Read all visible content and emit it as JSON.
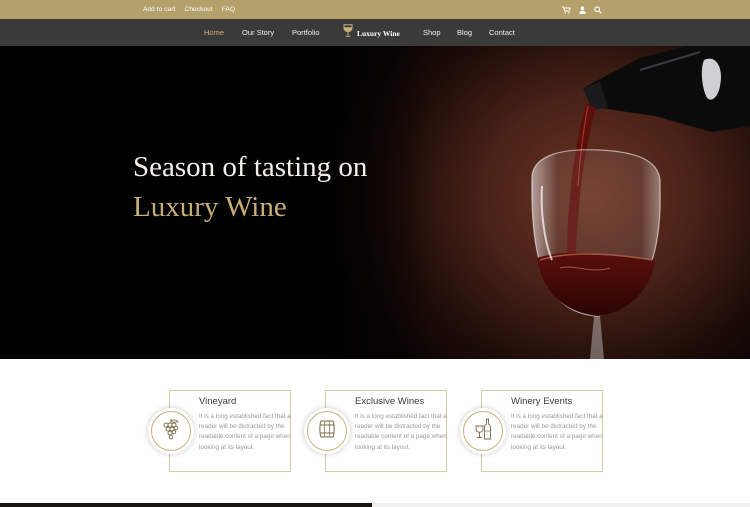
{
  "topbar": {
    "links": [
      "Add to cart",
      "Checkout",
      "FAQ"
    ],
    "icons": [
      "cart-icon",
      "user-icon",
      "search-icon"
    ]
  },
  "nav": {
    "items": [
      {
        "label": "Home",
        "active": true
      },
      {
        "label": "Our Story"
      },
      {
        "label": "Portfolio"
      },
      {
        "label": "Shop"
      },
      {
        "label": "Blog"
      },
      {
        "label": "Contact"
      }
    ],
    "logo_text": "Luxury Wine"
  },
  "hero": {
    "line1": "Season of tasting on",
    "line2": "Luxury Wine"
  },
  "features": [
    {
      "title": "Vineyard",
      "text": "It is a long established fact that a reader will be distracted by the readable content of a page when looking at its layout.",
      "icon": "grapes-icon"
    },
    {
      "title": "Exclusive Wines",
      "text": "It is a long established fact that a reader will be distracted by the readable content of a page when looking at its layout.",
      "icon": "barrel-icon"
    },
    {
      "title": "Winery Events",
      "text": "It is a long established fact that a reader will be distracted by the readable content of a page when looking at its layout.",
      "icon": "bottle-glass-icon"
    }
  ],
  "colors": {
    "gold": "#b4a06a",
    "nav_bg": "#3a3a3a",
    "accent_text": "#c6ad78"
  }
}
